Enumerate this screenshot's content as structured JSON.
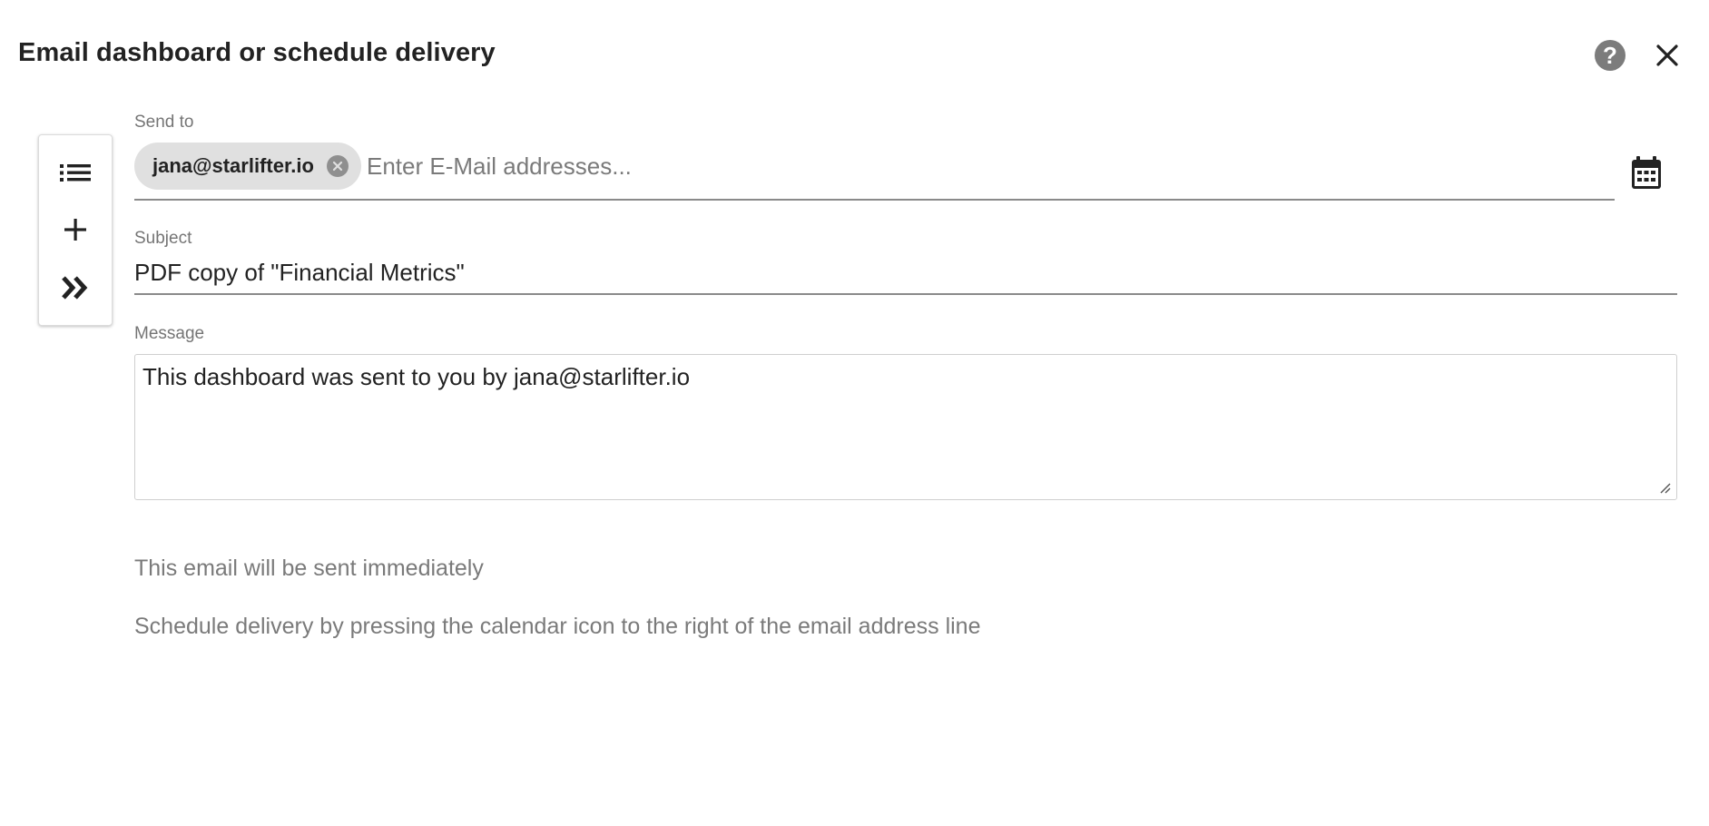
{
  "dialog": {
    "title": "Email dashboard or schedule delivery",
    "help_icon": "help-circle-icon",
    "help_glyph": "?",
    "close_icon": "close-icon"
  },
  "toolbar": {
    "items": [
      {
        "icon": "list-icon"
      },
      {
        "icon": "plus-icon"
      },
      {
        "icon": "double-chevron-right-icon"
      }
    ]
  },
  "send_to": {
    "label": "Send to",
    "recipients": [
      "jana@starlifter.io"
    ],
    "placeholder": "Enter E-Mail addresses...",
    "value": "",
    "calendar_icon": "calendar-icon"
  },
  "subject": {
    "label": "Subject",
    "value": "PDF copy of \"Financial Metrics\""
  },
  "message": {
    "label": "Message",
    "value": "This dashboard was sent to you by jana@starlifter.io"
  },
  "info": {
    "immediate": "This email will be sent immediately",
    "schedule_hint": "Schedule delivery by pressing the calendar icon to the right of the email address line"
  },
  "colors": {
    "chip_bg": "#e0e0e0",
    "label_gray": "#757575",
    "icon_dark": "#212121",
    "help_bg": "#7c7c7c"
  }
}
